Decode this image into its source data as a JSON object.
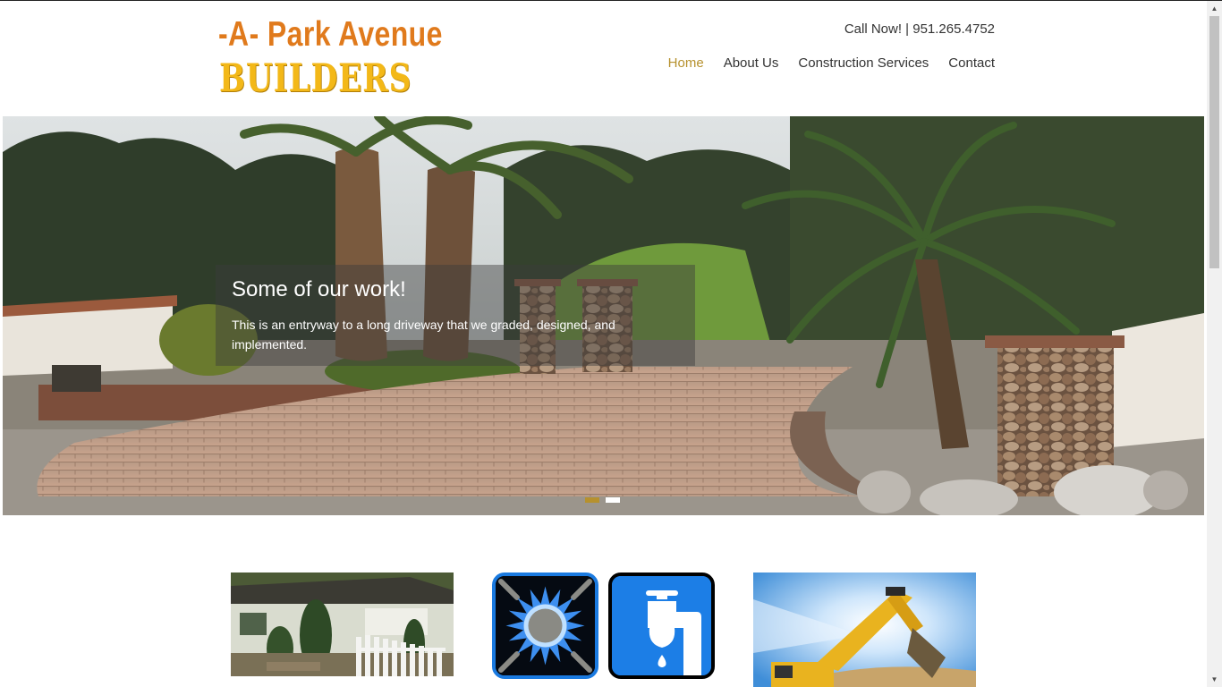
{
  "header": {
    "logo_line1": "-A- Park Avenue",
    "logo_line2": "BUILDERS",
    "call_now": "Call Now! | 951.265.4752",
    "nav": [
      {
        "label": "Home",
        "active": true
      },
      {
        "label": "About Us"
      },
      {
        "label": "Construction Services"
      },
      {
        "label": "Contact"
      }
    ]
  },
  "hero": {
    "caption_title": "Some of our work!",
    "caption_text": "This is an entryway to a long driveway that we graded, designed, and implemented.",
    "slide_count": 2,
    "active_slide": 1
  },
  "features": [
    {
      "icon": "house-photo"
    },
    {
      "icon": "gas-burner-icon"
    },
    {
      "icon": "water-faucet-icon"
    },
    {
      "icon": "excavator-photo"
    }
  ],
  "colors": {
    "accent": "#b6912e",
    "logo_orange": "#e07a1c",
    "logo_yellow": "#f3b818",
    "icon_blue": "#1a7ae0"
  }
}
